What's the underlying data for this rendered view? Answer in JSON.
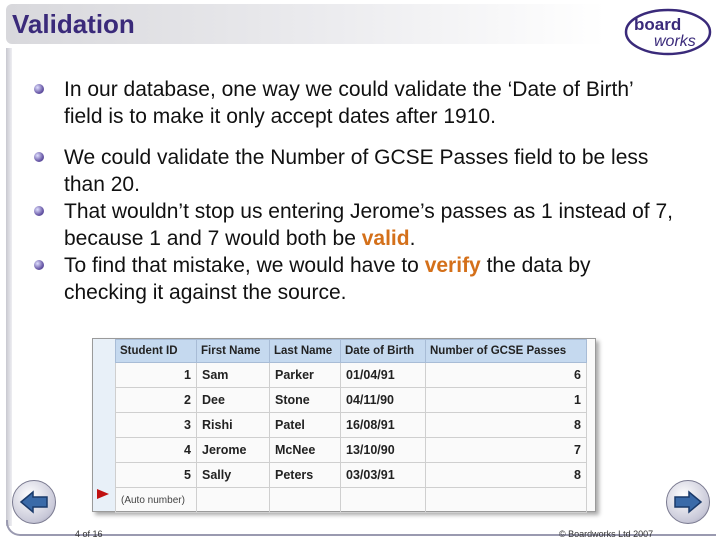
{
  "header": {
    "title": "Validation",
    "logo_line1": "board",
    "logo_line2": "works"
  },
  "bullets": {
    "b1": "In our database, one way we could validate the ‘Date of Birth’ field is to make it only accept dates after 1910.",
    "b2": "We could validate the Number of GCSE Passes field to be less than 20.",
    "b3_pre": "That wouldn’t stop us entering Jerome’s passes as 1 instead of 7, because 1 and 7 would both be ",
    "b3_hl": "valid",
    "b3_post": ".",
    "b4_pre": "To find that mistake, we would have to ",
    "b4_hl": "verify",
    "b4_post": " the data by checking it against the source."
  },
  "table": {
    "headers": [
      "Student ID",
      "First Name",
      "Last Name",
      "Date of Birth",
      "Number of GCSE Passes"
    ],
    "rows": [
      [
        "1",
        "Sam",
        "Parker",
        "01/04/91",
        "6"
      ],
      [
        "2",
        "Dee",
        "Stone",
        "04/11/90",
        "1"
      ],
      [
        "3",
        "Rishi",
        "Patel",
        "16/08/91",
        "8"
      ],
      [
        "4",
        "Jerome",
        "McNee",
        "13/10/90",
        "7"
      ],
      [
        "5",
        "Sally",
        "Peters",
        "03/03/91",
        "8"
      ]
    ],
    "new_row_label": "(Auto number)"
  },
  "footer": {
    "page": "4 of 16",
    "copyright": "© Boardworks Ltd 2007"
  },
  "colors": {
    "title": "#3a2a7a",
    "highlight": "#d4701a",
    "header_fill": "#c5d9ef"
  }
}
